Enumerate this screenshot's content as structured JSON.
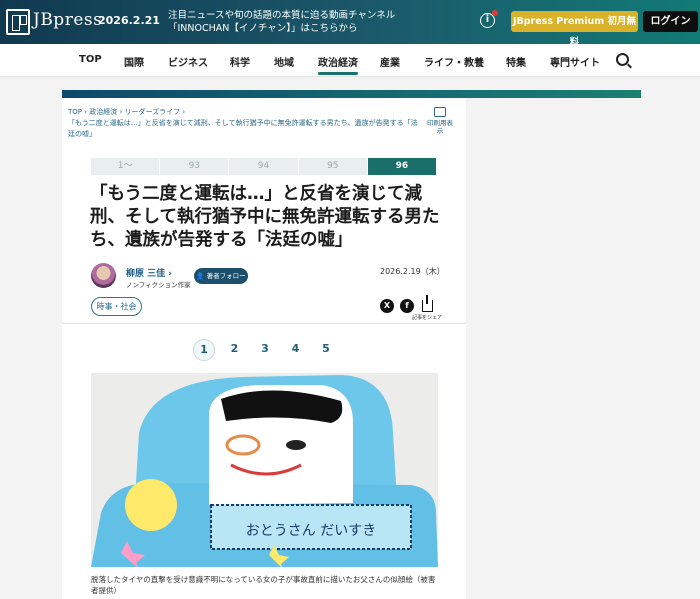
{
  "header": {
    "brand": "JBpress",
    "date": "2026.2.21",
    "promo_line1": "注目ニュースや旬の話題の本質に迫る動画チャンネル",
    "promo_line2": "「INNOCHAN【イノチャン】」はこちらから",
    "info_icon": "info-icon",
    "premium_label": "JBpress Premium 初月無料",
    "login_label": "ログイン",
    "colors": {
      "bar_start": "#10394f",
      "bar_end": "#127a75",
      "premium": "#d9b22a",
      "login": "#0e0e0e"
    }
  },
  "nav": {
    "items": [
      "TOP",
      "国際",
      "ビジネス",
      "科学",
      "地域",
      "政治経済",
      "産業",
      "ライフ・教養",
      "特集",
      "専門サイト"
    ],
    "active": "政治経済",
    "search_icon": "search-icon"
  },
  "article": {
    "breadcrumb": {
      "items": [
        "TOP",
        "政治経済",
        "リーダーズライフ"
      ],
      "current": "「もう二度と運転は…」と反省を演じて減刑、そして執行猶予中に無免許運転する男たち、遺族が告発する「法廷の嘘」"
    },
    "print_label": "印刷用表示",
    "series_pager": [
      "1～",
      "93",
      "94",
      "95",
      "96"
    ],
    "series_current": "96",
    "title": "「もう二度と運転は…」と反省を演じて減刑、そして執行猶予中に無免許運転する男たち、遺族が告発する「法廷の嘘」",
    "author": {
      "name": "柳原 三佳",
      "role": "ノンフィクション作家",
      "follow_label": "著者フォロー"
    },
    "published": "2026.2.19（木）",
    "tag": "時事・社会",
    "share": {
      "x_label": "X",
      "fb_label": "f",
      "share_label": "記事をシェア"
    },
    "pages": [
      "1",
      "2",
      "3",
      "4",
      "5"
    ],
    "current_page": "1",
    "photo_text": "おとうさん だいすき",
    "caption": "脱落したタイヤの直撃を受け意識不明になっている女の子が事故直前に描いたお父さんの似顔絵（被害者提供）",
    "accent_color": "#1a6f6b"
  }
}
